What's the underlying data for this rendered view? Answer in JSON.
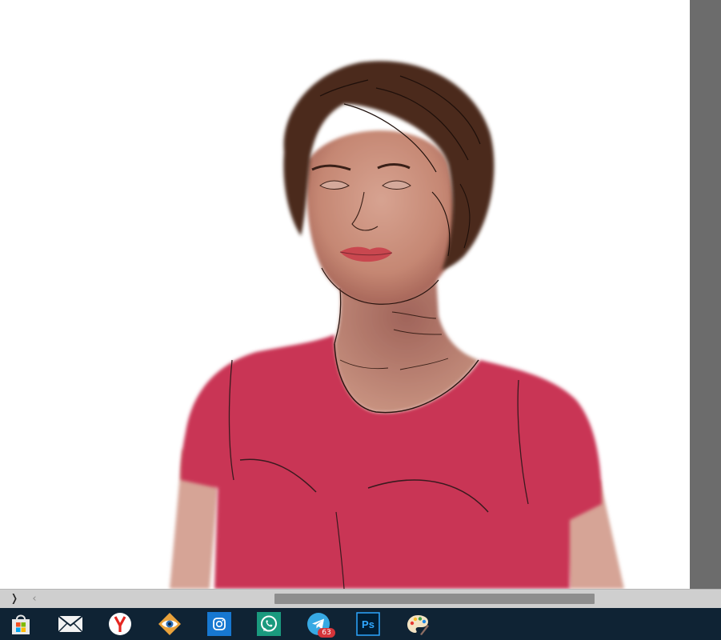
{
  "scrollbar": {
    "panel_toggle_glyph": "❭",
    "scroll_left_glyph": "‹"
  },
  "taskbar": {
    "apps": [
      {
        "name": "microsoft-store",
        "icon": "store-bag-icon"
      },
      {
        "name": "mail",
        "icon": "mail-envelope-icon"
      },
      {
        "name": "yandex-browser",
        "icon": "yandex-y-icon"
      },
      {
        "name": "faststone-viewer",
        "icon": "eye-viewer-icon"
      },
      {
        "name": "instagram",
        "icon": "instagram-icon"
      },
      {
        "name": "whatsapp",
        "icon": "whatsapp-icon"
      },
      {
        "name": "telegram",
        "icon": "telegram-icon",
        "badge": "63"
      },
      {
        "name": "photoshop",
        "icon": "photoshop-icon",
        "label": "Ps"
      },
      {
        "name": "paint",
        "icon": "paint-palette-icon"
      }
    ]
  },
  "colors": {
    "canvas": "#ffffff",
    "gutter": "#6c6c6c",
    "scrollbar": "#cfcfcf",
    "scroll_thumb": "#8e8e8e",
    "taskbar": "#0f2334",
    "shirt": "#c93655",
    "skin": "#c9917f",
    "hair": "#4b2a1f",
    "lips": "#c9474f"
  }
}
